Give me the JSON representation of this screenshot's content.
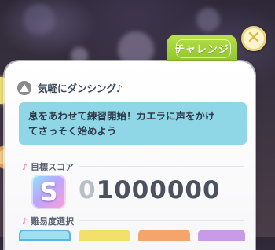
{
  "tab": {
    "label": "チャレンジ"
  },
  "song": {
    "title": "気軽にダンシング♪"
  },
  "message": {
    "line1": "息をあわせて練習開始！カエラに声をかけ",
    "line2": "てさっそく始めよう"
  },
  "target_score": {
    "label": "目標スコア",
    "rank": "S",
    "score_lead": "0",
    "score_value": "1000000"
  },
  "difficulty": {
    "label": "難易度選択"
  },
  "colors": {
    "tab": "#9fd23a",
    "message_bg": "#8fd6e6",
    "close": "#e9d57a",
    "note": "#e874a8"
  }
}
